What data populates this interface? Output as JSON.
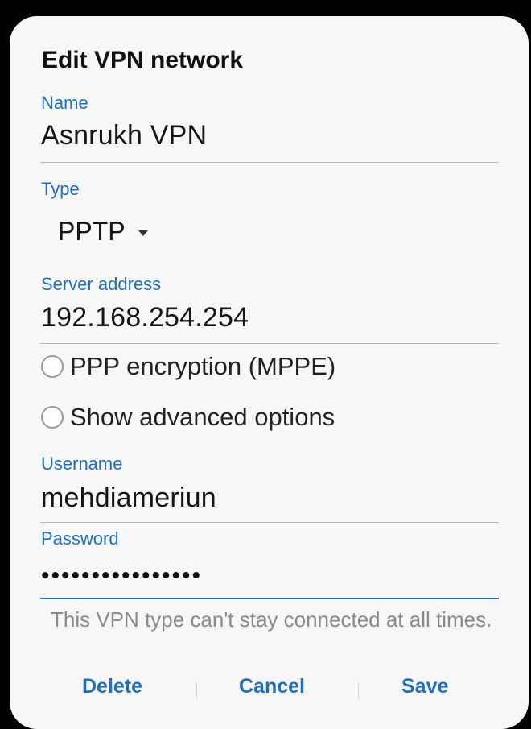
{
  "dialog": {
    "title": "Edit VPN network",
    "fields": {
      "name": {
        "label": "Name",
        "value": "Asnrukh VPN"
      },
      "type": {
        "label": "Type",
        "value": "PPTP"
      },
      "server": {
        "label": "Server address",
        "value": "192.168.254.254"
      },
      "username": {
        "label": "Username",
        "value": "mehdiameriun"
      },
      "password": {
        "label": "Password",
        "value": "••••••••••••••••"
      }
    },
    "options": {
      "ppp_encryption": "PPP encryption (MPPE)",
      "advanced": "Show advanced options"
    },
    "note": "This VPN type can't stay connected at all times.",
    "buttons": {
      "delete": "Delete",
      "cancel": "Cancel",
      "save": "Save"
    }
  },
  "colors": {
    "accent": "#1f6fc1",
    "background": "#f7f7f7",
    "text": "#161616",
    "note": "#8a8a8a"
  },
  "icons": {
    "type_dropdown": "chevron-down-icon",
    "ppp_radio": "radio-unchecked-icon",
    "advanced_radio": "radio-unchecked-icon"
  }
}
